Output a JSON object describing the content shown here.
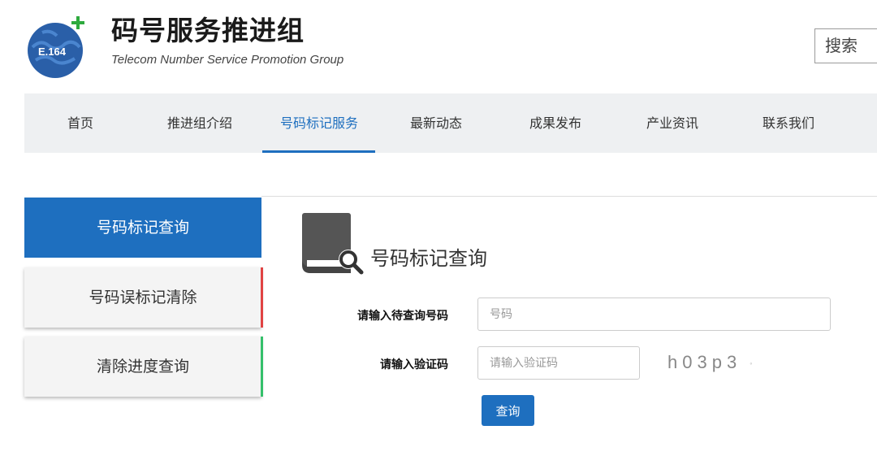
{
  "header": {
    "logo_text": "E.164",
    "title": "码号服务推进组",
    "subtitle": "Telecom Number Service  Promotion Group",
    "search_label": "搜索"
  },
  "nav": {
    "items": [
      {
        "label": "首页"
      },
      {
        "label": "推进组介绍"
      },
      {
        "label": "号码标记服务",
        "active": true
      },
      {
        "label": "最新动态"
      },
      {
        "label": "成果发布"
      },
      {
        "label": "产业资讯"
      },
      {
        "label": "联系我们"
      }
    ]
  },
  "sidebar": {
    "items": [
      {
        "label": "号码标记查询",
        "active": true
      },
      {
        "label": "号码误标记清除",
        "marker_color": "#e04343"
      },
      {
        "label": "清除进度查询",
        "marker_color": "#35c06b"
      }
    ]
  },
  "main": {
    "section_title": "号码标记查询",
    "form": {
      "number_label": "请输入待查询号码",
      "number_placeholder": "号码",
      "captcha_label": "请输入验证码",
      "captcha_placeholder": "请输入验证码",
      "captcha_text": "h03p3",
      "submit_label": "查询"
    }
  },
  "colors": {
    "primary": "#1e6fbf",
    "nav_bg": "#eef0f2",
    "marker_red": "#e04343",
    "marker_green": "#35c06b"
  }
}
